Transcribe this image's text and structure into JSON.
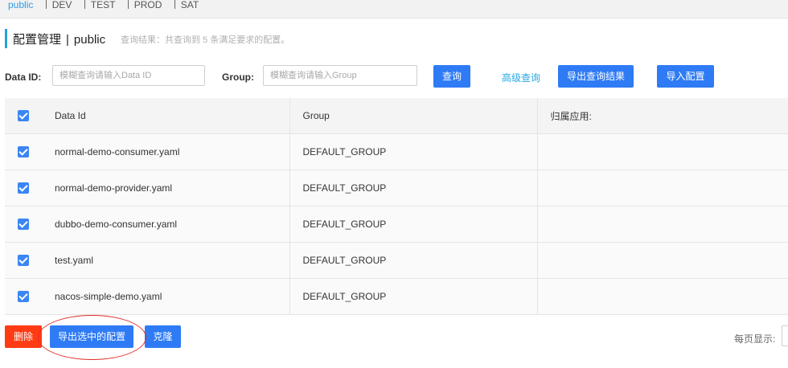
{
  "namespaces": [
    {
      "label": "public",
      "active": true
    },
    {
      "label": "DEV",
      "active": false
    },
    {
      "label": "TEST",
      "active": false
    },
    {
      "label": "PROD",
      "active": false
    },
    {
      "label": "SAT",
      "active": false
    }
  ],
  "header": {
    "title": "配置管理",
    "separator": "|",
    "namespace": "public",
    "result_text": "查询结果：共查询到 5 条满足要求的配置。"
  },
  "search": {
    "data_id_label": "Data ID:",
    "data_id_placeholder": "模糊查询请输入Data ID",
    "data_id_value": "",
    "group_label": "Group:",
    "group_placeholder": "模糊查询请输入Group",
    "group_value": "",
    "query_button": "查询",
    "advanced_link": "高级查询",
    "export_results_button": "导出查询结果",
    "import_button": "导入配置"
  },
  "table": {
    "columns": [
      "Data Id",
      "Group",
      "归属应用:"
    ],
    "rows": [
      {
        "data_id": "normal-demo-consumer.yaml",
        "group": "DEFAULT_GROUP",
        "app": "",
        "checked": true
      },
      {
        "data_id": "normal-demo-provider.yaml",
        "group": "DEFAULT_GROUP",
        "app": "",
        "checked": true
      },
      {
        "data_id": "dubbo-demo-consumer.yaml",
        "group": "DEFAULT_GROUP",
        "app": "",
        "checked": true
      },
      {
        "data_id": "test.yaml",
        "group": "DEFAULT_GROUP",
        "app": "",
        "checked": true
      },
      {
        "data_id": "nacos-simple-demo.yaml",
        "group": "DEFAULT_GROUP",
        "app": "",
        "checked": true
      }
    ]
  },
  "footer": {
    "delete_button": "删除",
    "export_selected_button": "导出选中的配置",
    "clone_button": "克隆",
    "per_page_label": "每页显示:"
  },
  "colors": {
    "primary": "#2e7bf5",
    "danger": "#ff3b14",
    "accent": "#29a0d9",
    "annotation": "#e52b2b"
  }
}
